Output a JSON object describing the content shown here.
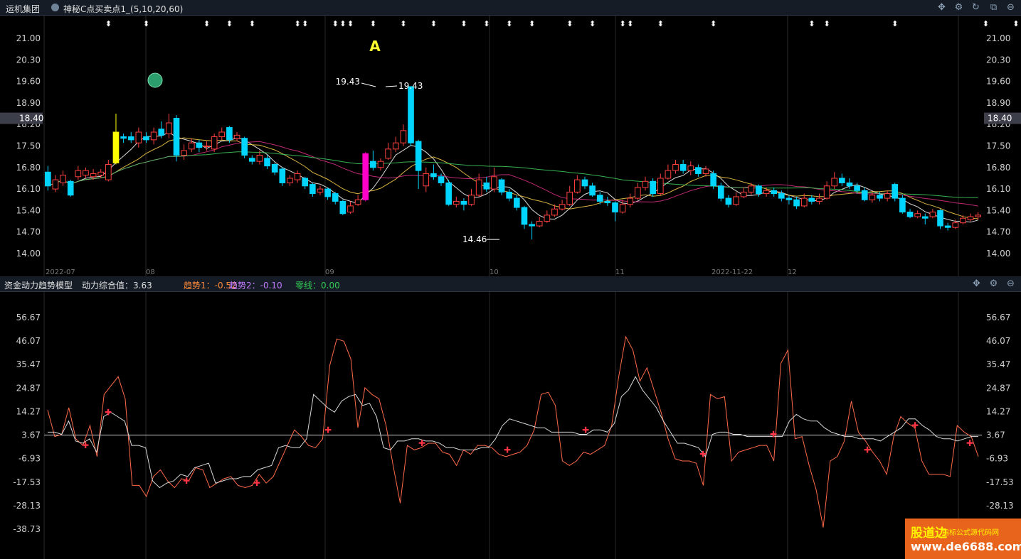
{
  "top_bar": {
    "group_name": "运机集团",
    "indicator_label": "神秘C点买卖点1_(5,10,20,60)"
  },
  "sub_bar": {
    "title": "资金动力趋势模型",
    "power_label": "动力综合值：3.63",
    "trend1_label": "趋势1：-0.52",
    "trend2_label": "趋势2：-0.10",
    "zero_label": "零线：0.00"
  },
  "watermark": {
    "line1": "股道边",
    "line1b": "指标公式源代码网",
    "line2": "www.de6688.com"
  },
  "colors": {
    "up": "#ff4040",
    "down": "#00d5ff",
    "yellow_bar": "#ffff00",
    "magenta_bar": "#ff00c8",
    "ma5": "#ffffff",
    "ma10": "#ffd24d",
    "ma20": "#e0308a",
    "ma60": "#40d060",
    "trend1": "#ff6a4a",
    "trend2": "#d8d8d8"
  },
  "chart_data": [
    {
      "type": "candlestick",
      "price_axis_ticks": [
        "21.00",
        "20.30",
        "19.60",
        "18.90",
        "18.20",
        "17.50",
        "16.80",
        "16.10",
        "15.40",
        "14.70",
        "14.00"
      ],
      "ylim": [
        13.3,
        21.3
      ],
      "current_price": "18.40",
      "month_labels": [
        "2022-07",
        "08",
        "09",
        "10",
        "11",
        "2022-11-22",
        "12"
      ],
      "annotations": {
        "marker": "A",
        "high_label": "19.43",
        "low_label": "14.46"
      },
      "candles": [
        [
          16.65,
          16.2,
          16.85,
          16.05
        ],
        [
          16.1,
          16.4,
          16.55,
          16.0
        ],
        [
          16.3,
          16.55,
          16.7,
          16.2
        ],
        [
          16.35,
          15.9,
          16.4,
          15.85
        ],
        [
          16.5,
          16.7,
          16.85,
          16.4
        ],
        [
          16.55,
          16.7,
          16.8,
          16.45
        ],
        [
          16.5,
          16.6,
          16.75,
          16.4
        ],
        [
          16.55,
          16.65,
          16.75,
          16.45
        ],
        [
          16.4,
          16.9,
          17.05,
          16.35
        ],
        [
          16.95,
          17.95,
          18.55,
          16.9
        ],
        [
          17.8,
          17.75,
          17.9,
          17.6
        ],
        [
          17.8,
          17.7,
          17.95,
          17.6
        ],
        [
          17.6,
          17.95,
          18.1,
          17.45
        ],
        [
          17.8,
          17.7,
          17.95,
          17.6
        ],
        [
          17.7,
          17.95,
          18.1,
          17.55
        ],
        [
          18.05,
          17.85,
          18.3,
          17.75
        ],
        [
          17.9,
          18.25,
          18.55,
          17.75
        ],
        [
          18.4,
          17.2,
          18.5,
          17.0
        ],
        [
          17.2,
          17.35,
          17.55,
          17.05
        ],
        [
          17.4,
          17.6,
          17.75,
          17.3
        ],
        [
          17.6,
          17.45,
          17.7,
          17.3
        ],
        [
          17.5,
          17.5,
          17.65,
          17.35
        ],
        [
          17.4,
          17.8,
          17.9,
          17.3
        ],
        [
          17.8,
          17.95,
          18.1,
          17.7
        ],
        [
          18.1,
          17.7,
          18.15,
          17.6
        ],
        [
          17.75,
          17.85,
          17.95,
          17.65
        ],
        [
          17.75,
          17.2,
          17.8,
          17.1
        ],
        [
          17.1,
          17.0,
          17.2,
          16.9
        ],
        [
          17.0,
          17.2,
          17.35,
          16.9
        ],
        [
          17.1,
          16.85,
          17.2,
          16.75
        ],
        [
          16.9,
          16.65,
          16.95,
          16.55
        ],
        [
          16.75,
          16.3,
          16.8,
          16.2
        ],
        [
          16.3,
          16.45,
          16.55,
          16.2
        ],
        [
          16.4,
          16.6,
          16.7,
          16.3
        ],
        [
          16.45,
          16.2,
          16.5,
          16.1
        ],
        [
          16.25,
          15.95,
          16.3,
          15.85
        ],
        [
          16.0,
          16.1,
          16.2,
          15.9
        ],
        [
          16.1,
          15.85,
          16.15,
          15.75
        ],
        [
          15.95,
          15.7,
          16.0,
          15.6
        ],
        [
          15.7,
          15.3,
          15.75,
          15.25
        ],
        [
          15.35,
          15.55,
          15.7,
          15.3
        ],
        [
          15.6,
          15.75,
          15.9,
          15.55
        ],
        [
          15.75,
          17.25,
          17.3,
          15.7
        ],
        [
          17.0,
          16.8,
          17.35,
          16.7
        ],
        [
          16.8,
          17.0,
          17.1,
          16.7
        ],
        [
          17.1,
          17.4,
          17.6,
          17.05
        ],
        [
          17.4,
          17.6,
          17.8,
          17.3
        ],
        [
          17.6,
          18.0,
          18.2,
          17.5
        ],
        [
          19.43,
          17.6,
          19.43,
          17.5
        ],
        [
          17.65,
          16.7,
          17.7,
          16.1
        ],
        [
          16.2,
          16.6,
          16.8,
          16.0
        ],
        [
          16.6,
          16.5,
          16.9,
          16.4
        ],
        [
          16.5,
          16.3,
          16.6,
          16.2
        ],
        [
          16.3,
          15.6,
          16.4,
          15.55
        ],
        [
          15.6,
          15.7,
          15.85,
          15.5
        ],
        [
          15.7,
          15.6,
          15.8,
          15.4
        ],
        [
          15.6,
          15.9,
          16.1,
          15.55
        ],
        [
          15.9,
          16.4,
          16.6,
          15.85
        ],
        [
          16.3,
          16.1,
          16.5,
          16.0
        ],
        [
          16.1,
          16.5,
          16.8,
          16.0
        ],
        [
          16.4,
          16.0,
          16.45,
          15.9
        ],
        [
          16.0,
          15.8,
          16.1,
          15.7
        ],
        [
          15.8,
          15.5,
          15.9,
          15.4
        ],
        [
          15.5,
          14.95,
          15.55,
          14.8
        ],
        [
          14.95,
          14.9,
          15.05,
          14.46
        ],
        [
          14.9,
          15.05,
          15.2,
          14.85
        ],
        [
          15.05,
          15.25,
          15.4,
          15.0
        ],
        [
          15.25,
          15.45,
          15.6,
          15.2
        ],
        [
          15.45,
          15.6,
          15.75,
          15.4
        ],
        [
          15.6,
          16.0,
          16.2,
          15.55
        ],
        [
          16.0,
          16.4,
          16.55,
          15.95
        ],
        [
          16.4,
          16.2,
          16.5,
          16.1
        ],
        [
          16.2,
          15.9,
          16.3,
          15.85
        ],
        [
          15.9,
          15.7,
          16.0,
          15.6
        ],
        [
          15.7,
          15.65,
          15.85,
          15.55
        ],
        [
          15.65,
          15.35,
          15.7,
          15.05
        ],
        [
          15.35,
          15.6,
          15.75,
          15.3
        ],
        [
          15.6,
          15.8,
          15.95,
          15.5
        ],
        [
          15.8,
          16.15,
          16.3,
          15.75
        ],
        [
          16.15,
          16.35,
          16.5,
          16.05
        ],
        [
          16.35,
          15.95,
          16.45,
          15.85
        ],
        [
          15.95,
          16.45,
          16.6,
          15.9
        ],
        [
          16.45,
          16.7,
          16.9,
          16.4
        ],
        [
          16.7,
          16.9,
          17.05,
          16.6
        ],
        [
          16.9,
          16.7,
          17.05,
          16.6
        ],
        [
          16.7,
          16.85,
          17.0,
          16.55
        ],
        [
          16.8,
          16.6,
          16.9,
          16.5
        ],
        [
          16.6,
          16.75,
          16.85,
          16.5
        ],
        [
          16.6,
          16.2,
          16.7,
          16.1
        ],
        [
          16.2,
          15.8,
          16.3,
          15.7
        ],
        [
          15.8,
          15.6,
          15.9,
          15.5
        ],
        [
          15.6,
          15.85,
          16.0,
          15.55
        ],
        [
          15.85,
          16.0,
          16.15,
          15.8
        ],
        [
          16.0,
          16.2,
          16.3,
          15.9
        ],
        [
          16.2,
          15.95,
          16.25,
          15.85
        ],
        [
          15.95,
          16.05,
          16.15,
          15.85
        ],
        [
          16.05,
          15.95,
          16.15,
          15.85
        ],
        [
          15.95,
          15.8,
          16.05,
          15.7
        ],
        [
          15.8,
          15.75,
          15.9,
          15.6
        ],
        [
          15.75,
          15.55,
          15.85,
          15.45
        ],
        [
          15.55,
          15.8,
          15.95,
          15.5
        ],
        [
          15.8,
          15.7,
          15.9,
          15.6
        ],
        [
          15.7,
          15.8,
          15.95,
          15.6
        ],
        [
          15.8,
          16.2,
          16.35,
          15.75
        ],
        [
          16.2,
          16.45,
          16.65,
          16.1
        ],
        [
          16.45,
          16.3,
          16.6,
          16.2
        ],
        [
          16.3,
          16.2,
          16.45,
          16.1
        ],
        [
          16.2,
          16.05,
          16.3,
          15.95
        ],
        [
          16.05,
          15.75,
          16.15,
          15.7
        ],
        [
          15.75,
          15.9,
          16.0,
          15.65
        ],
        [
          15.9,
          15.8,
          16.0,
          15.7
        ],
        [
          15.8,
          15.95,
          16.05,
          15.7
        ],
        [
          16.25,
          15.8,
          16.3,
          15.7
        ],
        [
          15.8,
          15.35,
          15.9,
          15.3
        ],
        [
          15.35,
          15.2,
          15.45,
          15.15
        ],
        [
          15.2,
          15.3,
          15.4,
          15.15
        ],
        [
          15.2,
          15.15,
          15.3,
          14.95
        ],
        [
          15.2,
          15.35,
          15.45,
          15.15
        ],
        [
          15.4,
          14.9,
          15.45,
          14.8
        ],
        [
          14.9,
          14.85,
          15.0,
          14.75
        ],
        [
          14.85,
          15.0,
          15.1,
          14.8
        ],
        [
          15.0,
          15.15,
          15.25,
          14.95
        ],
        [
          15.1,
          15.2,
          15.3,
          15.05
        ],
        [
          15.2,
          15.25,
          15.35,
          15.1
        ]
      ]
    },
    {
      "type": "line",
      "title": "资金动力趋势模型",
      "y_axis_ticks": [
        "56.67",
        "46.07",
        "35.47",
        "24.87",
        "14.27",
        "3.67",
        "-6.93",
        "-17.53",
        "-28.13",
        "-38.73"
      ],
      "ylim": [
        -45,
        63
      ],
      "zero_line": 3.67,
      "series": [
        {
          "name": "趋势1",
          "values": [
            15,
            3,
            4,
            16,
            2,
            -1,
            8,
            -6,
            22,
            26,
            30,
            20,
            -19,
            -19,
            -24,
            -15,
            -12,
            -17,
            -20,
            -16,
            -17,
            -11,
            -12,
            -20,
            -18,
            -16,
            -15,
            -19,
            -20,
            -19,
            -14,
            -18,
            -15,
            -8,
            -1,
            6,
            3,
            -1,
            -2,
            2,
            35,
            47,
            46,
            38,
            7,
            25,
            22,
            20,
            8,
            -10,
            -27,
            -1,
            -3,
            -2,
            0,
            0,
            -4,
            -5,
            -10,
            -3,
            -5,
            -1,
            -1,
            -2,
            -5,
            -6,
            -5,
            -4,
            -1,
            6,
            22,
            23,
            17,
            -8,
            -10,
            -8,
            -4,
            -5,
            -3,
            -1,
            8,
            30,
            48,
            42,
            28,
            34,
            24,
            14,
            2,
            -7,
            -8,
            -8,
            -9,
            -19,
            22,
            20,
            21,
            -8,
            -4,
            -3,
            -2,
            -1,
            -1,
            -8,
            36,
            42,
            2,
            3,
            -10,
            -21,
            -38,
            -8,
            -6,
            1,
            19,
            5,
            1,
            -4,
            -8,
            -14,
            3,
            12,
            9,
            7,
            -8,
            -14,
            -14,
            -14,
            -15,
            8,
            5,
            3,
            -6
          ]
        },
        {
          "name": "趋势2",
          "values": [
            5,
            5,
            4,
            10,
            1,
            0,
            2,
            -4,
            12,
            14,
            12,
            10,
            -1,
            -1,
            -2,
            -17,
            -20,
            -18,
            -17,
            -14,
            -15,
            -11,
            -10,
            -9,
            -18,
            -17,
            -16,
            -16,
            -15,
            -15,
            -12,
            -11,
            -10,
            -2,
            -1,
            -2,
            -2,
            2,
            22,
            19,
            16,
            14,
            19,
            21,
            22,
            17,
            18,
            12,
            -2,
            -3,
            1,
            1,
            2,
            2,
            1,
            1,
            0,
            -2,
            -2,
            -3,
            -3,
            -3,
            -2,
            -2,
            2,
            8,
            11,
            10,
            9,
            8,
            7,
            7,
            5,
            5,
            5,
            5,
            4,
            4,
            6,
            6,
            5,
            9,
            21,
            24,
            30,
            24,
            20,
            16,
            10,
            5,
            0,
            0,
            -1,
            -2,
            -6,
            4,
            5,
            5,
            4,
            4,
            3,
            3,
            3,
            3,
            3,
            3,
            10,
            13,
            11,
            10,
            10,
            7,
            5,
            4,
            3,
            3,
            2,
            2,
            2,
            1,
            3,
            5,
            7,
            11,
            11,
            8,
            6,
            3,
            2,
            2,
            1,
            2,
            3,
            3
          ]
        }
      ]
    }
  ]
}
